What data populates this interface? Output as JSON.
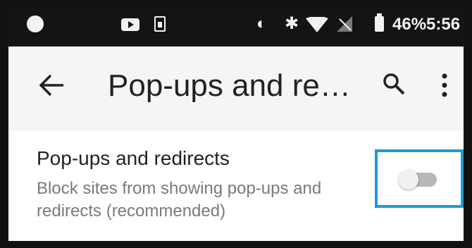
{
  "status_bar": {
    "battery_percent": "46%",
    "time": "5:56",
    "icons": [
      "record-icon",
      "youtube-icon",
      "sim-card-icon",
      "data-saver-icon",
      "bluetooth-icon",
      "wifi-icon",
      "no-signal-icon",
      "battery-icon"
    ]
  },
  "toolbar": {
    "title": "Pop-ups and re…",
    "icons": [
      "back-arrow-icon",
      "search-icon",
      "more-vert-icon"
    ]
  },
  "setting": {
    "title": "Pop-ups and redirects",
    "description": "Block sites from showing pop-ups and redirects (recommended)",
    "toggle_on": false
  },
  "colors": {
    "highlight_border": "#1e9ad6",
    "toolbar_bg": "#f5f5f5",
    "status_bar_bg": "#141414"
  }
}
